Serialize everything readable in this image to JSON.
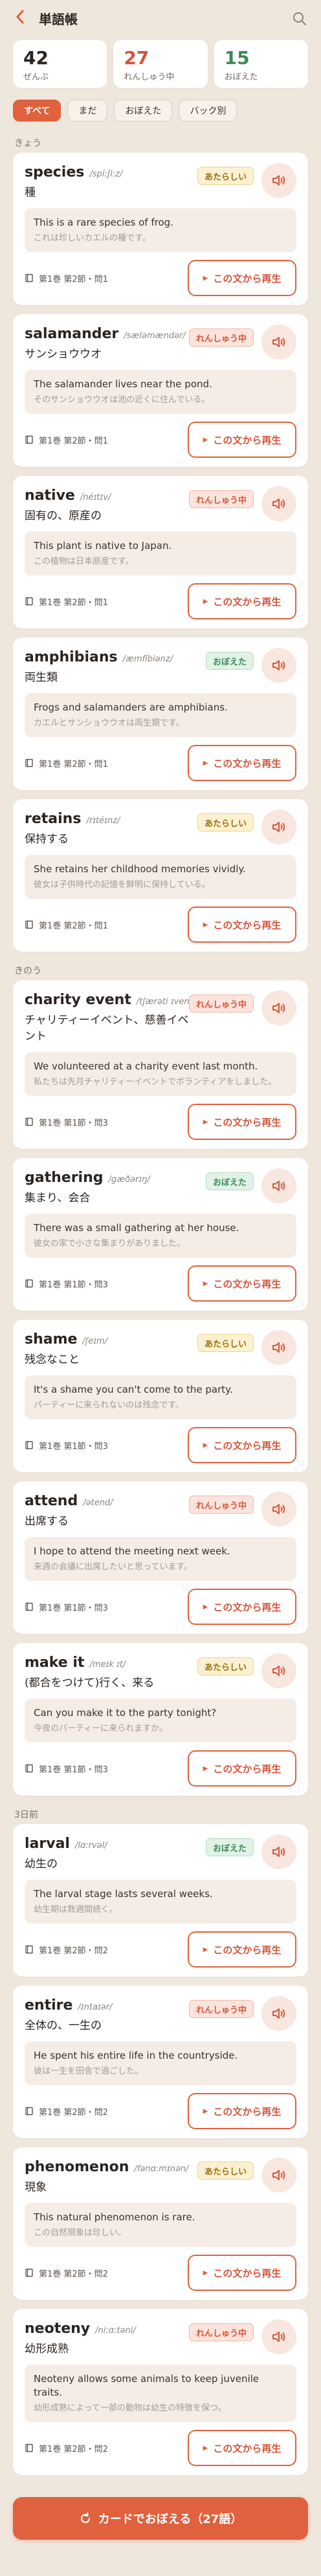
{
  "header": {
    "title": "単語帳",
    "back_icon": "chevron-left-icon",
    "search_icon": "search-icon"
  },
  "stats": [
    {
      "value": "42",
      "label": "ぜんぶ",
      "color": "#2b2420"
    },
    {
      "value": "27",
      "label": "れんしゅう中",
      "color": "#d4553a"
    },
    {
      "value": "15",
      "label": "おぼえた",
      "color": "#3c8a55"
    }
  ],
  "filters": [
    "すべて",
    "まだ",
    "おぼえた",
    "バック別"
  ],
  "replay_label": "この文から再生",
  "sections": [
    {
      "title": "きょう",
      "cards": [
        {
          "word": "species",
          "ipa": "/spíːʃiːz/",
          "meaning": "種",
          "badge": "あたらしい",
          "badge_type": "uncertain",
          "ex_en": "This is a rare species of frog.",
          "ex_ja": "これは珍しいカエルの種です。",
          "source": "第1巻 第2節・問1"
        },
        {
          "word": "salamander",
          "ipa": "/sæləmændər/",
          "meaning": "サンショウウオ",
          "badge": "れんしゅう中",
          "badge_type": "learning",
          "ex_en": "The salamander lives near the pond.",
          "ex_ja": "そのサンショウウオは池の近くに住んでいる。",
          "source": "第1巻 第2節・問1"
        },
        {
          "word": "native",
          "ipa": "/néɪtɪv/",
          "meaning": "固有の、原産の",
          "badge": "れんしゅう中",
          "badge_type": "learning",
          "ex_en": "This plant is native to Japan.",
          "ex_ja": "この植物は日本原産です。",
          "source": "第1巻 第2節・問1"
        },
        {
          "word": "amphibians",
          "ipa": "/æmfíbiənz/",
          "meaning": "両生類",
          "badge": "おぼえた",
          "badge_type": "mastered",
          "ex_en": "Frogs and salamanders are amphibians.",
          "ex_ja": "カエルとサンショウウオは両生類です。",
          "source": "第1巻 第2節・問1"
        },
        {
          "word": "retains",
          "ipa": "/rɪtéɪnz/",
          "meaning": "保持する",
          "badge": "あたらしい",
          "badge_type": "uncertain",
          "ex_en": "She retains her childhood memories vividly.",
          "ex_ja": "彼女は子供時代の記憶を鮮明に保持している。",
          "source": "第1巻 第2節・問1"
        }
      ]
    },
    {
      "title": "きのう",
      "cards": [
        {
          "word": "charity event",
          "ipa": "/tʃærəti ɪvent/",
          "meaning": "チャリティーイベント、慈善イベント",
          "badge": "れんしゅう中",
          "badge_type": "learning",
          "ex_en": "We volunteered at a charity event last month.",
          "ex_ja": "私たちは先月チャリティーイベントでボランティアをしました。",
          "source": "第1巻 第1節・問3"
        },
        {
          "word": "gathering",
          "ipa": "/gæðərɪŋ/",
          "meaning": "集まり、会合",
          "badge": "おぼえた",
          "badge_type": "mastered",
          "ex_en": "There was a small gathering at her house.",
          "ex_ja": "彼女の家で小さな集まりがありました。",
          "source": "第1巻 第1節・問3"
        },
        {
          "word": "shame",
          "ipa": "/ʃeɪm/",
          "meaning": "残念なこと",
          "badge": "あたらしい",
          "badge_type": "uncertain",
          "ex_en": "It's a shame you can't come to the party.",
          "ex_ja": "パーティーに来られないのは残念です。",
          "source": "第1巻 第1節・問3"
        },
        {
          "word": "attend",
          "ipa": "/ətend/",
          "meaning": "出席する",
          "badge": "れんしゅう中",
          "badge_type": "learning",
          "ex_en": "I hope to attend the meeting next week.",
          "ex_ja": "来週の会議に出席したいと思っています。",
          "source": "第1巻 第1節・問3"
        },
        {
          "word": "make it",
          "ipa": "/meɪk ɪt/",
          "meaning": "(都合をつけて)行く、来る",
          "badge": "あたらしい",
          "badge_type": "uncertain",
          "ex_en": "Can you make it to the party tonight?",
          "ex_ja": "今夜のパーティーに来られますか。",
          "source": "第1巻 第1節・問3"
        }
      ]
    },
    {
      "title": "3日前",
      "cards": [
        {
          "word": "larval",
          "ipa": "/lɑːrvəl/",
          "meaning": "幼生の",
          "badge": "おぼえた",
          "badge_type": "mastered",
          "ex_en": "The larval stage lasts several weeks.",
          "ex_ja": "幼生期は数週間続く。",
          "source": "第1巻 第2節・問2"
        },
        {
          "word": "entire",
          "ipa": "/ɪntaɪər/",
          "meaning": "全体の、一生の",
          "badge": "れんしゅう中",
          "badge_type": "learning",
          "ex_en": "He spent his entire life in the countryside.",
          "ex_ja": "彼は一生を田舎で過ごした。",
          "source": "第1巻 第2節・問2"
        },
        {
          "word": "phenomenon",
          "ipa": "/fənɑːmɪnən/",
          "meaning": "現象",
          "badge": "あたらしい",
          "badge_type": "uncertain",
          "ex_en": "This natural phenomenon is rare.",
          "ex_ja": "この自然現象は珍しい。",
          "source": "第1巻 第2節・問2"
        },
        {
          "word": "neoteny",
          "ipa": "/niːɑːtəni/",
          "meaning": "幼形成熟",
          "badge": "れんしゅう中",
          "badge_type": "learning",
          "ex_en": "Neoteny allows some animals to keep juvenile traits.",
          "ex_ja": "幼形成熟によって一部の動物は幼生の特徴を保つ。",
          "source": "第1巻 第2節・問2"
        }
      ]
    }
  ],
  "cta": {
    "label": "カードでおぼえる（27語）",
    "icon": "refresh-icon"
  },
  "colors": {
    "accent": "#e0613d",
    "background": "#efe6dc",
    "mastered": "#3c8a55"
  }
}
